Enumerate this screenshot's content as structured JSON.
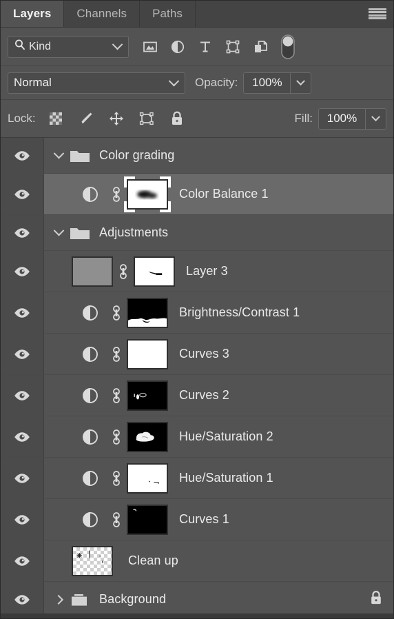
{
  "panel": {
    "tabs": [
      {
        "label": "Layers",
        "active": true
      },
      {
        "label": "Channels",
        "active": false
      },
      {
        "label": "Paths",
        "active": false
      }
    ],
    "menu_icon": "hamburger-menu-icon"
  },
  "filter": {
    "kind_label": "Kind",
    "search_icon": "search-icon",
    "chevron_icon": "chevron-down-icon",
    "type_filters": [
      {
        "name": "filter-pixel-layers-icon",
        "title": "Pixel layers"
      },
      {
        "name": "filter-adjustment-layers-icon",
        "title": "Adjustment layers"
      },
      {
        "name": "filter-type-layers-icon",
        "title": "Type layers"
      },
      {
        "name": "filter-shape-layers-icon",
        "title": "Shape layers"
      },
      {
        "name": "filter-smart-object-icon",
        "title": "Smart objects"
      }
    ],
    "toggle_icon": "filter-enable-toggle",
    "toggle_on": true
  },
  "blend": {
    "mode": "Normal",
    "opacity_label": "Opacity:",
    "opacity_value": "100%",
    "fill_label": "Fill:",
    "fill_value": "100%"
  },
  "lock": {
    "label": "Lock:",
    "items": [
      {
        "name": "lock-transparent-pixels-icon"
      },
      {
        "name": "lock-image-pixels-icon"
      },
      {
        "name": "lock-position-icon"
      },
      {
        "name": "lock-artboard-nesting-icon"
      },
      {
        "name": "lock-all-icon"
      }
    ]
  },
  "layers": [
    {
      "name": "Color grading",
      "type": "group",
      "expanded": true,
      "visible": true,
      "selected": false,
      "indent": 0,
      "locked": false
    },
    {
      "name": "Color Balance 1",
      "type": "adjustment",
      "visible": true,
      "selected": true,
      "indent": 1,
      "has_adjustment_icon": true,
      "has_link": true,
      "mask": "white-with-dark-blob",
      "mask_selected": true,
      "locked": false
    },
    {
      "name": "Adjustments",
      "type": "group",
      "expanded": true,
      "visible": true,
      "selected": false,
      "indent": 0,
      "locked": false
    },
    {
      "name": "Layer 3",
      "type": "pixel",
      "visible": true,
      "selected": false,
      "indent": 1,
      "thumbnail": "gray-noise",
      "has_link": true,
      "mask": "white-with-small-dark-stroke",
      "locked": false
    },
    {
      "name": "Brightness/Contrast 1",
      "type": "adjustment",
      "visible": true,
      "selected": false,
      "indent": 1,
      "has_adjustment_icon": true,
      "has_link": true,
      "mask": "black-with-white-bottom",
      "locked": false
    },
    {
      "name": "Curves 3",
      "type": "adjustment",
      "visible": true,
      "selected": false,
      "indent": 1,
      "has_adjustment_icon": true,
      "has_link": true,
      "mask": "all-white",
      "locked": false
    },
    {
      "name": "Curves 2",
      "type": "adjustment",
      "visible": true,
      "selected": false,
      "indent": 1,
      "has_adjustment_icon": true,
      "has_link": true,
      "mask": "black-with-white-marks",
      "locked": false
    },
    {
      "name": "Hue/Saturation 2",
      "type": "adjustment",
      "visible": true,
      "selected": false,
      "indent": 1,
      "has_adjustment_icon": true,
      "has_link": true,
      "mask": "black-with-white-cloud",
      "locked": false
    },
    {
      "name": "Hue/Saturation 1",
      "type": "adjustment",
      "visible": true,
      "selected": false,
      "indent": 1,
      "has_adjustment_icon": true,
      "has_link": true,
      "mask": "white-with-small-marks",
      "locked": false
    },
    {
      "name": "Curves 1",
      "type": "adjustment",
      "visible": true,
      "selected": false,
      "indent": 1,
      "has_adjustment_icon": true,
      "has_link": true,
      "mask": "black-with-corner-mark",
      "locked": false
    },
    {
      "name": "Clean up",
      "type": "pixel",
      "visible": true,
      "selected": false,
      "indent": 1,
      "thumbnail": "transparent-checker",
      "has_link": false,
      "mask": null,
      "locked": false
    },
    {
      "name": "Background",
      "type": "group",
      "expanded": false,
      "visible": true,
      "selected": false,
      "indent": 0,
      "locked": true
    }
  ],
  "colors": {
    "panel_bg": "#535353",
    "tabbar_bg": "#444444",
    "eye_column_bg": "#4b4b4b",
    "selected_row_bg": "#6a6a6a",
    "text": "#eaeaea",
    "field_bg": "#4b4b4b",
    "field_border": "#6a6a6a"
  },
  "icons": {
    "eye": "visibility-eye-icon",
    "link": "link-mask-icon",
    "adjustment": "adjustment-half-circle-icon",
    "folder_open": "folder-open-icon",
    "folder_closed": "folder-closed-icon",
    "lock": "lock-icon"
  }
}
